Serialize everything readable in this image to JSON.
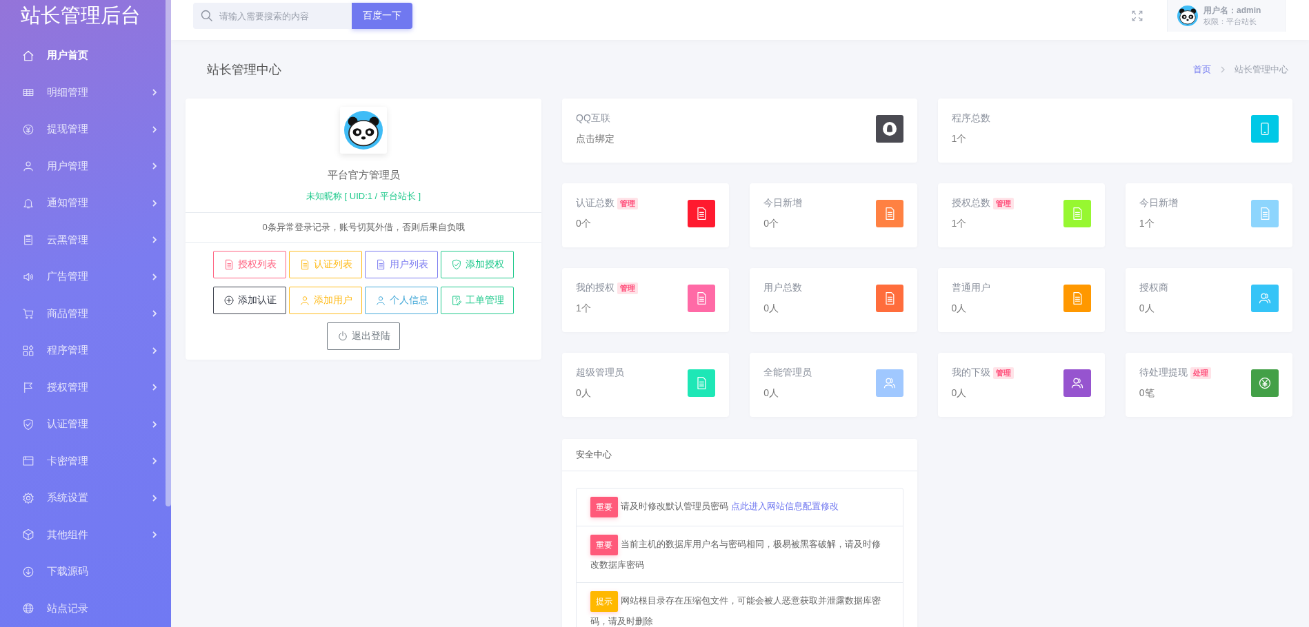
{
  "sidebar": {
    "title": "站长管理后台",
    "items": [
      {
        "label": "用户首页",
        "kind": "home",
        "selected": true,
        "expandable": false
      },
      {
        "label": "明细管理",
        "kind": "table",
        "selected": false,
        "expandable": true
      },
      {
        "label": "提现管理",
        "kind": "yen",
        "selected": false,
        "expandable": true
      },
      {
        "label": "用户管理",
        "kind": "user",
        "selected": false,
        "expandable": true
      },
      {
        "label": "通知管理",
        "kind": "bell",
        "selected": false,
        "expandable": true
      },
      {
        "label": "云黑管理",
        "kind": "clipboard",
        "selected": false,
        "expandable": true
      },
      {
        "label": "广告管理",
        "kind": "speaker",
        "selected": false,
        "expandable": true
      },
      {
        "label": "商品管理",
        "kind": "cart",
        "selected": false,
        "expandable": true
      },
      {
        "label": "程序管理",
        "kind": "apps",
        "selected": false,
        "expandable": true
      },
      {
        "label": "授权管理",
        "kind": "flag",
        "selected": false,
        "expandable": true
      },
      {
        "label": "认证管理",
        "kind": "shield",
        "selected": false,
        "expandable": true
      },
      {
        "label": "卡密管理",
        "kind": "card",
        "selected": false,
        "expandable": true
      },
      {
        "label": "系统设置",
        "kind": "gear",
        "selected": false,
        "expandable": true
      },
      {
        "label": "其他组件",
        "kind": "cube",
        "selected": false,
        "expandable": true
      },
      {
        "label": "下载源码",
        "kind": "download",
        "selected": false,
        "expandable": false
      },
      {
        "label": "站点记录",
        "kind": "globe",
        "selected": false,
        "expandable": false
      }
    ]
  },
  "topbar": {
    "search": {
      "placeholder": "请输入需要搜索的内容"
    },
    "search_button": "百度一下",
    "user": {
      "name": "用户名：admin",
      "role": "权限：平台站长"
    }
  },
  "page": {
    "title": "站长管理中心",
    "breadcrumb": [
      {
        "label": "首页",
        "selected": false
      },
      {
        "label": "站长管理中心",
        "selected": true
      }
    ]
  },
  "profile": {
    "name": "平台官方管理员",
    "subtitle": "未知昵称 [ UID:1 / 平台站长 ]",
    "notice": "0条异常登录记录，账号切莫外借，否则后果自负哦",
    "buttons": [
      {
        "label": "授权列表",
        "kind": "doc",
        "color": "#ff5f7e"
      },
      {
        "label": "认证列表",
        "kind": "doc",
        "color": "#ffbb1a"
      },
      {
        "label": "用户列表",
        "kind": "doc",
        "color": "#7a7af0"
      },
      {
        "label": "添加授权",
        "kind": "shield",
        "color": "#1ec98b"
      },
      {
        "label": "添加认证",
        "kind": "plus",
        "color": "#3a3f4b"
      },
      {
        "label": "添加用户",
        "kind": "user",
        "color": "#ffbb1a"
      },
      {
        "label": "个人信息",
        "kind": "user",
        "color": "#45a9d8"
      },
      {
        "label": "工单管理",
        "kind": "edit",
        "color": "#1ec98b"
      },
      {
        "label": "退出登陆",
        "kind": "power",
        "color": "#6c757d"
      }
    ]
  },
  "stats": [
    {
      "label": "QQ互联",
      "value": "点击绑定",
      "kind": "qq",
      "color": "#4a4a52",
      "wide": true
    },
    {
      "label": "程序总数",
      "value": "1个",
      "kind": "phone",
      "color": "#00c8e6",
      "wide": true
    },
    {
      "label": "认证总数",
      "badge": "管理",
      "value": "0个",
      "kind": "doc",
      "color": "#ff1a2f",
      "wide": false
    },
    {
      "label": "今日新增",
      "value": "0个",
      "kind": "doc",
      "color": "#ff8142",
      "wide": false
    },
    {
      "label": "授权总数",
      "badge": "管理",
      "value": "1个",
      "kind": "doc",
      "color": "#97f731",
      "wide": false
    },
    {
      "label": "今日新增",
      "value": "1个",
      "kind": "doc",
      "color": "#8dd5fd",
      "wide": false
    },
    {
      "label": "我的授权",
      "badge": "管理",
      "value": "1个",
      "kind": "doc",
      "color": "#ff6aa6",
      "wide": false
    },
    {
      "label": "用户总数",
      "value": "0人",
      "kind": "doc",
      "color": "#ff6d3c",
      "wide": false
    },
    {
      "label": "普通用户",
      "value": "0人",
      "kind": "doc",
      "color": "#ff9800",
      "wide": false
    },
    {
      "label": "授权商",
      "value": "0人",
      "kind": "users",
      "color": "#35c4f7",
      "wide": false
    },
    {
      "label": "超级管理员",
      "value": "0人",
      "kind": "doc",
      "color": "#1ee7b6",
      "wide": false
    },
    {
      "label": "全能管理员",
      "value": "0人",
      "kind": "users",
      "color": "#a0c8ff",
      "wide": false
    },
    {
      "label": "我的下级",
      "badge": "管理",
      "value": "0人",
      "kind": "users",
      "color": "#9654cf",
      "wide": false
    },
    {
      "label": "待处理提现",
      "badge": "处理",
      "value": "0笔",
      "kind": "yen",
      "color": "#43a047",
      "wide": false
    }
  ],
  "security": {
    "title": "安全中心",
    "items": [
      {
        "tag": "重要",
        "color": "#ff5a7a",
        "text": "请及时修改默认管理员密码",
        "link": "点此进入网站信息配置修改"
      },
      {
        "tag": "重要",
        "color": "#ff5a7a",
        "text": "当前主机的数据库用户名与密码相同，极易被黑客破解，请及时修改数据库密码"
      },
      {
        "tag": "提示",
        "color": "#ffb800",
        "text": "网站根目录存在压缩包文件，可能会被人恶意获取并泄露数据库密码，请及时删除"
      }
    ]
  }
}
